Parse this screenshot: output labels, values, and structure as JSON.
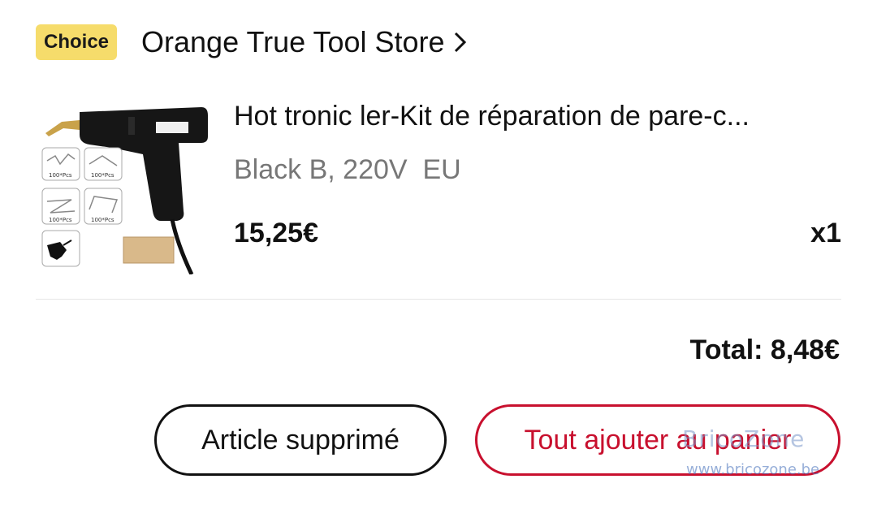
{
  "store": {
    "badge": "Choice",
    "name": "Orange True Tool Store"
  },
  "product": {
    "title": "Hot tronic ler-Kit de réparation de pare-c...",
    "variant": "Black B, 220V  EU",
    "price": "15,25€",
    "quantity": "x1",
    "image_labels": [
      "100*Pcs",
      "100*Pcs",
      "100*Pcs",
      "100*Pcs"
    ]
  },
  "summary": {
    "total": "Total: 8,48€"
  },
  "buttons": {
    "removed": "Article supprimé",
    "add_all": "Tout ajouter au panier"
  },
  "watermark": {
    "brand": "BricoZone",
    "url": "www.bricozone.be"
  },
  "colors": {
    "badge_bg": "#f6dc6b",
    "accent_red": "#c8102e",
    "muted_text": "#777777"
  }
}
